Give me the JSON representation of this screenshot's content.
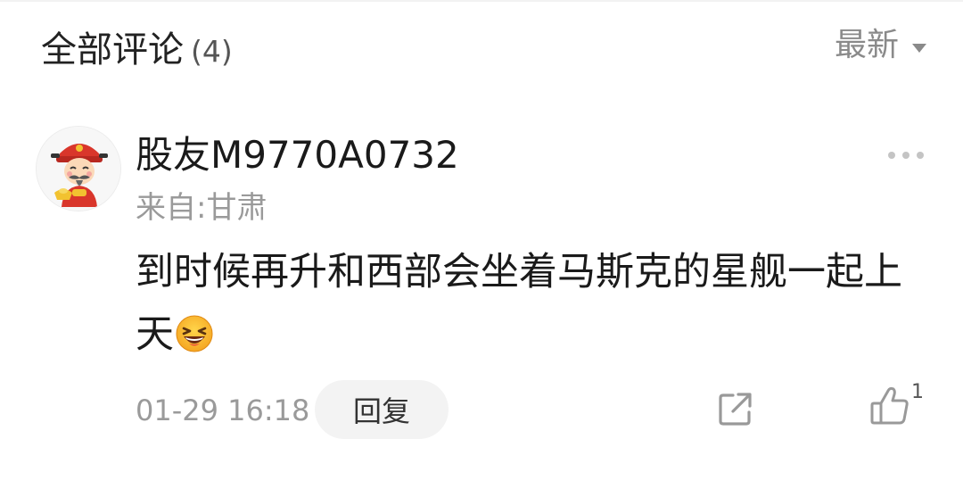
{
  "header": {
    "title": "全部评论",
    "count": "(4)",
    "sort_label": "最新",
    "sort_caret_icon": "caret-down-icon"
  },
  "comment": {
    "username": "股友M9770A0732",
    "location": "来自:甘肃",
    "text": "到时候再升和西部会坐着马斯克的星舰一起上天",
    "emoji_icon": "laughing-face-emoji",
    "timestamp": "01-29 16:18",
    "reply_label": "回复",
    "like_count": "1",
    "avatar_icon": "god-of-wealth-avatar",
    "more_icon": "more-dots-icon",
    "share_icon": "share-external-icon",
    "like_icon": "thumbs-up-icon"
  },
  "colors": {
    "text_primary": "#1a1a1a",
    "text_secondary": "#9a9a9a",
    "reply_bg": "#f3f3f3",
    "icon_gray": "#999999"
  }
}
